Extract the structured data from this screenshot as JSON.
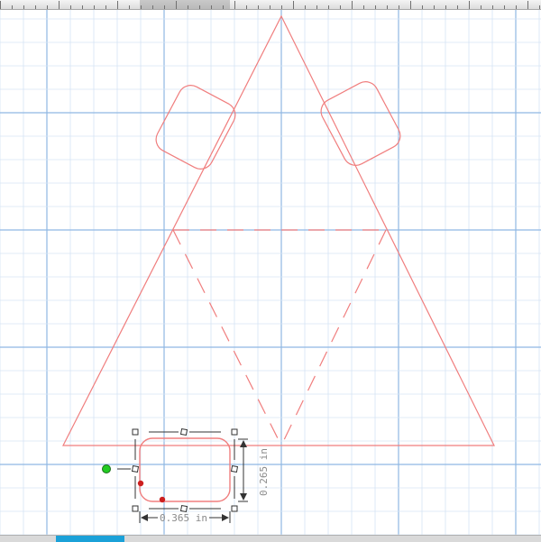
{
  "colors": {
    "grid_major": "#8fb7e3",
    "grid_minor": "#d6e5f5",
    "cut_line": "#f07e7e",
    "handle": "#333333",
    "anchor_green": "#22cc22",
    "node_red": "#cc1f1f",
    "dimension_text": "#8a8a8a",
    "status_tab": "#1ba1d8"
  },
  "canvas": {
    "dimensions": {
      "width_label": "0.365 in",
      "height_label": "0.265 in"
    }
  },
  "icons": {
    "anchor_point": "green-anchor-dot-icon",
    "selection_handle": "square-handle-icon",
    "node": "red-node-dot-icon"
  }
}
